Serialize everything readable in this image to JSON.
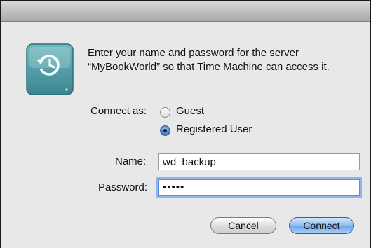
{
  "dialog": {
    "icon": "time-machine-drive-icon",
    "message": "Enter your name and password for the server “MyBookWorld” so that Time Machine can access it.",
    "connect_as_label": "Connect as:",
    "options": [
      {
        "label": "Guest",
        "selected": false
      },
      {
        "label": "Registered User",
        "selected": true
      }
    ],
    "name_label": "Name:",
    "name_value": "wd_backup",
    "password_label": "Password:",
    "password_mask": "•••••",
    "cancel_label": "Cancel",
    "connect_label": "Connect"
  },
  "colors": {
    "focus_ring": "#8fb6ea",
    "default_button": "#8fbdf0",
    "drive_teal": "#4f9ea6"
  }
}
